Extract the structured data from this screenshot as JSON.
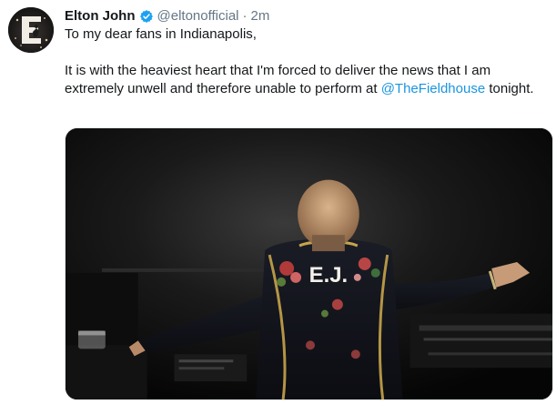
{
  "tweet": {
    "author": {
      "display_name": "Elton John",
      "handle": "@eltonofficial",
      "verified": true,
      "avatar_letter": "E"
    },
    "separator": "·",
    "timestamp": "2m",
    "text": {
      "line1": "To my dear fans in Indianapolis,",
      "para2_before": "It is with the heaviest heart that I'm forced to deliver the news that I am extremely unwell and therefore unable to perform at ",
      "mention": "@TheFieldhouse",
      "para2_after": " tonight."
    },
    "media": {
      "type": "photo",
      "jacket_text": "E.J."
    }
  },
  "colors": {
    "text_primary": "#14171a",
    "text_secondary": "#657786",
    "link": "#1b95e0",
    "verified_badge": "#1da1f2",
    "media_background": "#0b0b0b"
  },
  "icons": {
    "verified": "verified-badge-icon"
  }
}
